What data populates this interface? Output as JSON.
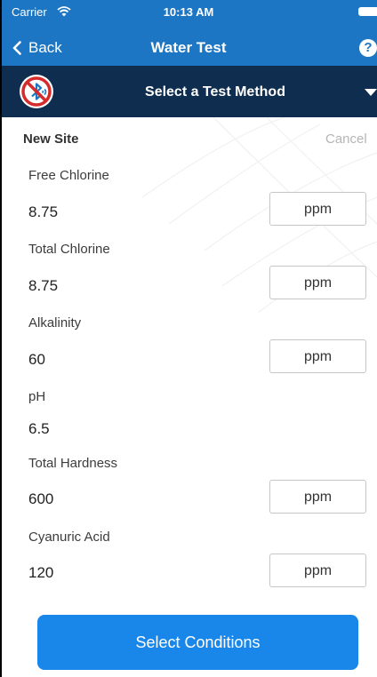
{
  "status_bar": {
    "carrier": "Carrier",
    "time": "10:13 AM"
  },
  "nav_bar": {
    "back_label": "Back",
    "title": "Water Test",
    "help_symbol": "?"
  },
  "method_bar": {
    "label": "Select a Test Method",
    "bluetooth_status_icon": "bluetooth-off-icon"
  },
  "form": {
    "site_name": "New Site",
    "cancel_label": "Cancel",
    "fields": [
      {
        "label": "Free Chlorine",
        "value": "8.75",
        "unit": "ppm"
      },
      {
        "label": "Total Chlorine",
        "value": "8.75",
        "unit": "ppm"
      },
      {
        "label": "Alkalinity",
        "value": "60",
        "unit": "ppm"
      },
      {
        "label": "pH",
        "value": "6.5"
      },
      {
        "label": "Total Hardness",
        "value": "600",
        "unit": "ppm"
      },
      {
        "label": "Cyanuric Acid",
        "value": "120",
        "unit": "ppm"
      }
    ]
  },
  "primary_action": {
    "label": "Select Conditions"
  },
  "colors": {
    "nav_blue": "#1d76c3",
    "method_bar_navy": "#0f2e4f",
    "button_blue": "#1987ea",
    "cancel_gray": "#b5b5b5"
  }
}
